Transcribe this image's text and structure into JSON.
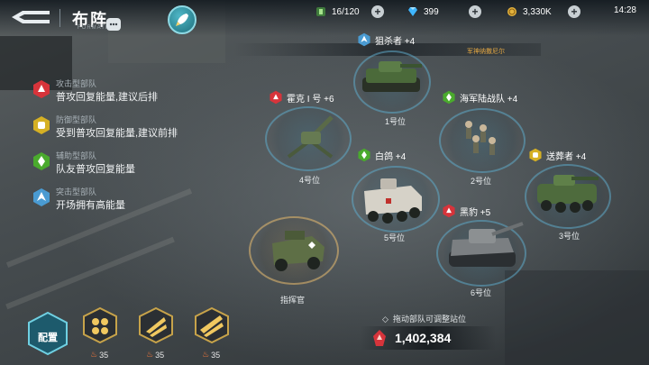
{
  "header": {
    "title": "布阵",
    "subtitle": "FORMATION",
    "resources": [
      {
        "icon": "energy-icon",
        "value": "16/120"
      },
      {
        "icon": "diamond-icon",
        "value": "399"
      },
      {
        "icon": "gold-coin-icon",
        "value": "3,330K"
      }
    ],
    "time": "14:28"
  },
  "roles": [
    {
      "category": "攻击型部队",
      "desc": "普攻回复能量,建议后排",
      "color": "#d7343b"
    },
    {
      "category": "防御型部队",
      "desc": "受到普攻回复能量,建议前排",
      "color": "#d5b024"
    },
    {
      "category": "辅助型部队",
      "desc": "队友普攻回复能量",
      "color": "#4aaa2d"
    },
    {
      "category": "突击型部队",
      "desc": "开场拥有高能量",
      "color": "#4a9bd2"
    }
  ],
  "event_text": "军神纳撒尼尔",
  "slots": [
    {
      "label": "1号位",
      "unit": "狙杀者 +4",
      "type_color": "#4a9bd2"
    },
    {
      "label": "2号位",
      "unit": "海军陆战队 +4",
      "type_color": "#4aaa2d"
    },
    {
      "label": "3号位",
      "unit": "送葬者 +4",
      "type_color": "#d5b024"
    },
    {
      "label": "4号位",
      "unit": "霍克 I 号 +6",
      "type_color": "#d7343b"
    },
    {
      "label": "5号位",
      "unit": "白鸽 +4",
      "type_color": "#4aaa2d"
    },
    {
      "label": "6号位",
      "unit": "黑豹 +5",
      "type_color": "#d7343b"
    },
    {
      "label": "指挥官",
      "unit": "",
      "type_color": ""
    }
  ],
  "hint": "拖动部队可调整站位",
  "power": "1,402,384",
  "deploy_label": "配置",
  "formations": [
    {
      "cost": "35"
    },
    {
      "cost": "35"
    },
    {
      "cost": "35"
    }
  ]
}
